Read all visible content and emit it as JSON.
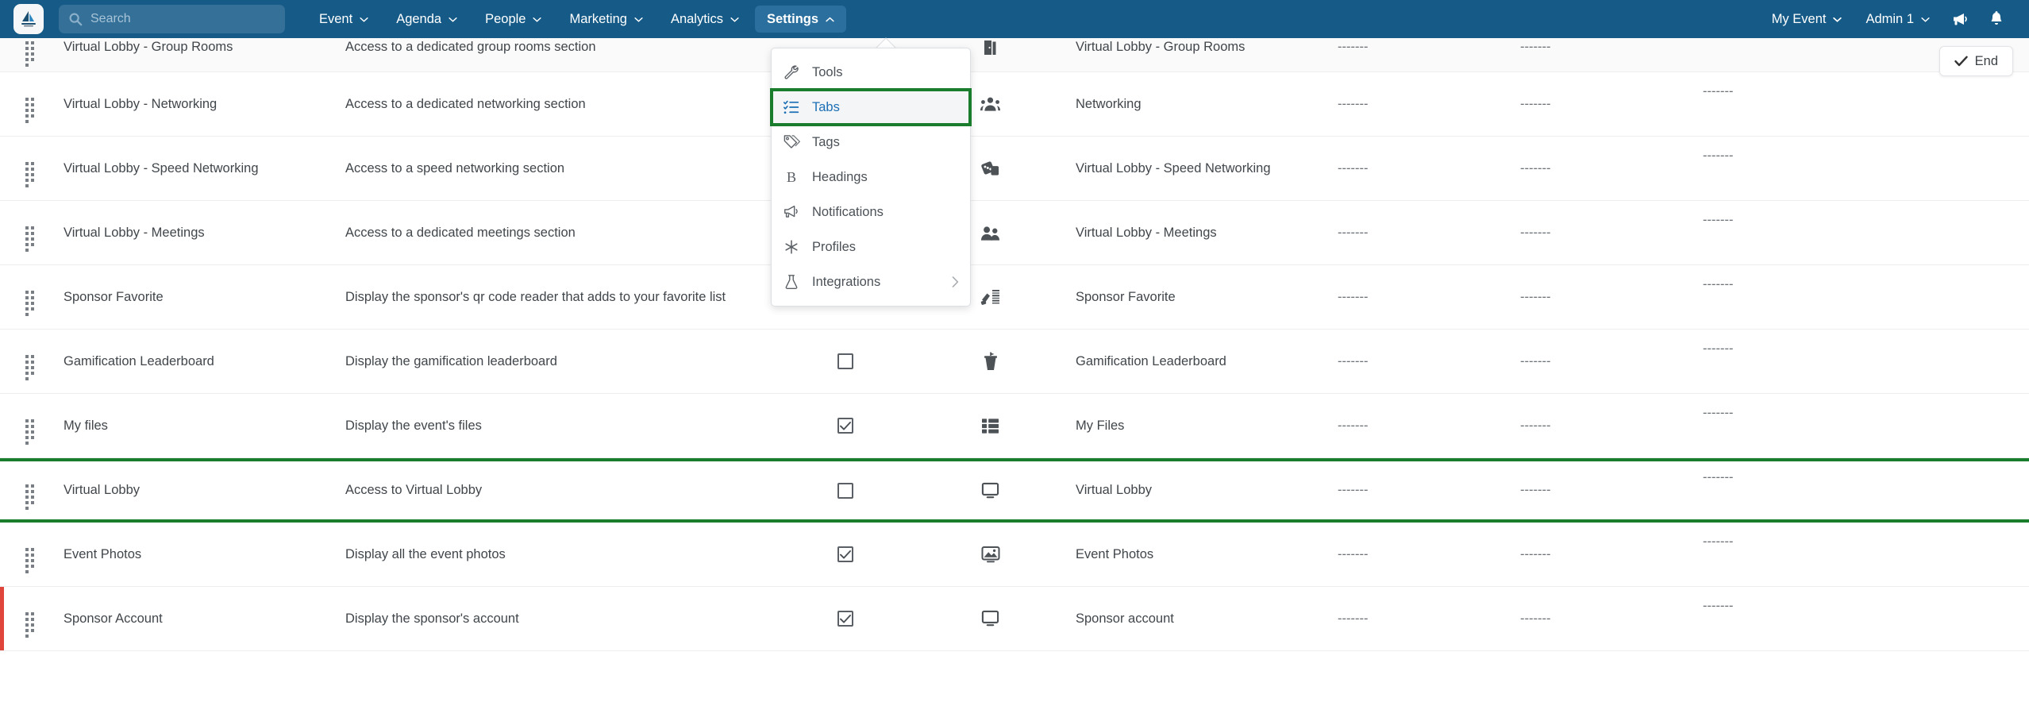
{
  "topnav": {
    "logo_icon": "sailboat-logo-icon",
    "search": {
      "placeholder": "Search",
      "value": "",
      "icon": "search-icon"
    },
    "menu_items": [
      {
        "label": "Event",
        "icon": "chevron-down-icon",
        "active": false
      },
      {
        "label": "Agenda",
        "icon": "chevron-down-icon",
        "active": false
      },
      {
        "label": "People",
        "icon": "chevron-down-icon",
        "active": false
      },
      {
        "label": "Marketing",
        "icon": "chevron-down-icon",
        "active": false
      },
      {
        "label": "Analytics",
        "icon": "chevron-down-icon",
        "active": false
      },
      {
        "label": "Settings",
        "icon": "chevron-up-icon",
        "active": true
      }
    ],
    "right_items": [
      {
        "label": "My Event",
        "icon": "chevron-down-icon"
      },
      {
        "label": "Admin 1",
        "icon": "chevron-down-icon"
      }
    ],
    "right_icons": [
      {
        "name": "megaphone-icon"
      },
      {
        "name": "bell-icon"
      }
    ],
    "background_color": "#165b88",
    "active_item_color": "#2a6f9e"
  },
  "dropdown": {
    "open_for": "Settings",
    "selected_highlight_color": "#1a7d2e",
    "selected_text_color": "#1c6fb5",
    "items": [
      {
        "label": "Tools",
        "icon": "wrench-icon",
        "selected": false,
        "has_submenu": false
      },
      {
        "label": "Tabs",
        "icon": "checklist-icon",
        "selected": true,
        "has_submenu": false
      },
      {
        "label": "Tags",
        "icon": "tags-icon",
        "selected": false,
        "has_submenu": false
      },
      {
        "label": "Headings",
        "icon": "bold-b-icon",
        "selected": false,
        "has_submenu": false
      },
      {
        "label": "Notifications",
        "icon": "megaphone-icon",
        "selected": false,
        "has_submenu": false
      },
      {
        "label": "Profiles",
        "icon": "asterisk-icon",
        "selected": false,
        "has_submenu": false
      },
      {
        "label": "Integrations",
        "icon": "flask-icon",
        "selected": false,
        "has_submenu": true,
        "submenu_icon": "chevron-right-icon"
      }
    ]
  },
  "toolbar": {
    "end_button": {
      "label": "End",
      "icon": "check-icon"
    }
  },
  "table": {
    "dash_placeholder": "-------",
    "rows": [
      {
        "name": "Virtual Lobby - Group Rooms",
        "description": "Access to a dedicated group rooms section",
        "checked": null,
        "icon": "door-open-icon",
        "label": "Virtual Lobby - Group Rooms",
        "d1": "-------",
        "d2": "-------",
        "d3": "",
        "state": "partial-top",
        "grip": "drag-grip-icon"
      },
      {
        "name": "Virtual Lobby - Networking",
        "description": "Access to a dedicated networking section",
        "checked": null,
        "icon": "users-group-icon",
        "label": "Networking",
        "d1": "-------",
        "d2": "-------",
        "d3": "-------",
        "state": "normal",
        "grip": "drag-grip-icon"
      },
      {
        "name": "Virtual Lobby - Speed Networking",
        "description": "Access to a speed networking section",
        "checked": null,
        "icon": "cards-icon",
        "label": "Virtual Lobby - Speed Networking",
        "d1": "-------",
        "d2": "-------",
        "d3": "-------",
        "state": "normal",
        "grip": "drag-grip-icon"
      },
      {
        "name": "Virtual Lobby - Meetings",
        "description": "Access to a dedicated meetings section",
        "checked": null,
        "icon": "two-people-icon",
        "label": "Virtual Lobby - Meetings",
        "d1": "-------",
        "d2": "-------",
        "d3": "-------",
        "state": "normal",
        "grip": "drag-grip-icon"
      },
      {
        "name": "Sponsor Favorite",
        "description": "Display the sponsor's qr code reader that adds to your favorite list",
        "checked": false,
        "icon": "barcode-scanner-icon",
        "label": "Sponsor Favorite",
        "d1": "-------",
        "d2": "-------",
        "d3": "-------",
        "state": "normal",
        "grip": "drag-grip-icon"
      },
      {
        "name": "Gamification Leaderboard",
        "description": "Display the gamification leaderboard",
        "checked": false,
        "icon": "podium-icon",
        "label": "Gamification Leaderboard",
        "d1": "-------",
        "d2": "-------",
        "d3": "-------",
        "state": "normal",
        "grip": "drag-grip-icon"
      },
      {
        "name": "My files",
        "description": "Display the event's files",
        "checked": true,
        "icon": "list-grid-icon",
        "label": "My Files",
        "d1": "-------",
        "d2": "-------",
        "d3": "-------",
        "state": "normal",
        "grip": "drag-grip-icon"
      },
      {
        "name": "Virtual Lobby",
        "description": "Access to Virtual Lobby",
        "checked": false,
        "icon": "monitor-icon",
        "label": "Virtual Lobby",
        "d1": "-------",
        "d2": "-------",
        "d3": "-------",
        "state": "highlighted",
        "grip": "drag-grip-icon"
      },
      {
        "name": "Event Photos",
        "description": "Display all the event photos",
        "checked": true,
        "icon": "photo-card-icon",
        "label": "Event Photos",
        "d1": "-------",
        "d2": "-------",
        "d3": "-------",
        "state": "normal",
        "grip": "drag-grip-icon"
      },
      {
        "name": "Sponsor Account",
        "description": "Display the sponsor's account",
        "checked": true,
        "icon": "monitor-icon",
        "label": "Sponsor account",
        "d1": "-------",
        "d2": "-------",
        "d3": "-------",
        "state": "flagged",
        "grip": "drag-grip-icon"
      }
    ]
  }
}
